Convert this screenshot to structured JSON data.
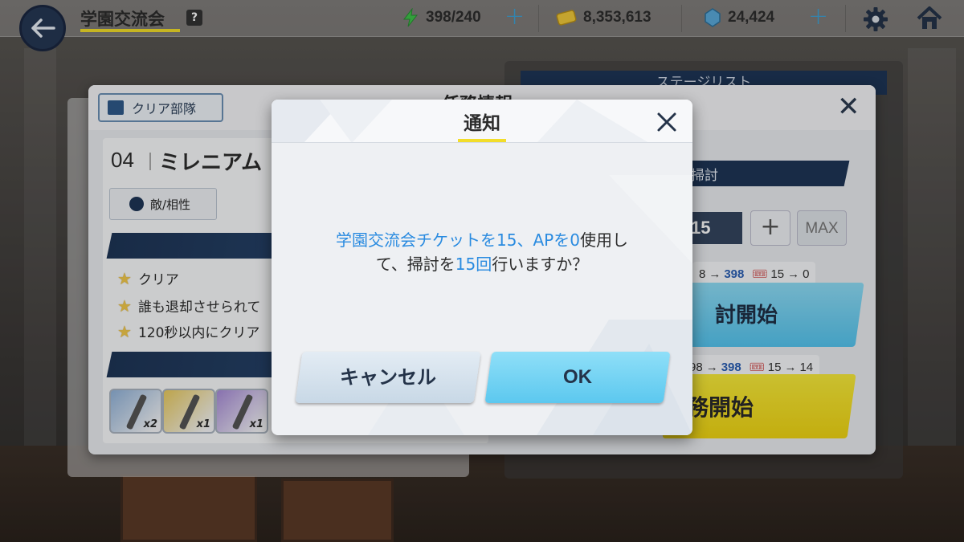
{
  "topbar": {
    "title": "学園交流会",
    "help": "?",
    "ap": "398/240",
    "credits": "8,353,613",
    "pyroxene": "24,424"
  },
  "background": {
    "stage_list_title": "ステージリスト"
  },
  "mission": {
    "title": "任務情報",
    "clear_team": "クリア部隊",
    "stage_no": "04",
    "stage_name": "ミレニアム",
    "enemy_button": "敵/相性",
    "goals": [
      "クリア",
      "誰も退却させられて",
      "120秒以内にクリア"
    ],
    "rewards": [
      {
        "count": "x2",
        "color": "#8fb1d8"
      },
      {
        "count": "x1",
        "color": "#e8c95c"
      },
      {
        "count": "x1",
        "color": "#a68ad6"
      }
    ],
    "sweep_label": "掃討",
    "sweep_count": "15",
    "sweep_plus": "+",
    "sweep_max": "MAX",
    "sweep_cost_ap": "8",
    "sweep_cost_ap_after": "398",
    "sweep_cost_ticket": "15",
    "sweep_cost_ticket_after": "0",
    "sweep_start": "討開始",
    "mission_cost_ap": "98",
    "mission_cost_ap_after": "398",
    "mission_cost_ticket": "15",
    "mission_cost_ticket_after": "14",
    "mission_start": "務開始",
    "arrow": "→"
  },
  "modal": {
    "title": "通知",
    "message_line1_parts": [
      "学園交流会チケットを15、APを0",
      "使用し"
    ],
    "message_line2_parts": [
      "て、掃討を",
      "15回",
      "行いますか？"
    ],
    "cancel": "キャンセル",
    "ok": "OK"
  },
  "colors": {
    "accent_yellow": "#f2dd2a",
    "highlight_blue": "#2a8be0",
    "ok_button": "#5cc8ef",
    "navy": "#1e3556"
  }
}
